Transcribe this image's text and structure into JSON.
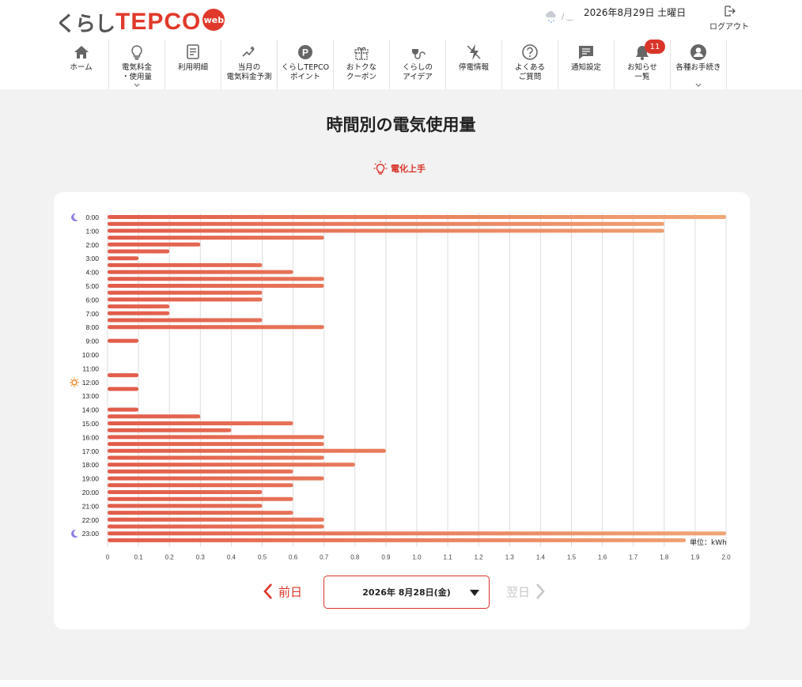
{
  "header": {
    "logo_kurashi": "くらし",
    "logo_tepco": "TEPCO",
    "logo_web": "web",
    "weather_icon": "cloud-rain-icon",
    "weather_text": "/ ‿",
    "date": "2026年8月29日 土曜日",
    "logout_label": "ログアウト"
  },
  "nav": [
    {
      "label": "ホーム",
      "icon": "home-icon"
    },
    {
      "label": "電気料金\n・使用量",
      "icon": "bulb-icon",
      "chevron": true
    },
    {
      "label": "利用明細",
      "icon": "document-icon"
    },
    {
      "label": "当月の\n電気料金予測",
      "icon": "forecast-icon"
    },
    {
      "label": "くらしTEPCO\nポイント",
      "icon": "point-icon"
    },
    {
      "label": "おトクな\nクーポン",
      "icon": "gift-icon"
    },
    {
      "label": "くらしの\nアイデア",
      "icon": "plug-icon"
    },
    {
      "label": "停電情報",
      "icon": "outage-icon"
    },
    {
      "label": "よくある\nご質問",
      "icon": "question-icon"
    },
    {
      "label": "通知設定",
      "icon": "message-icon"
    },
    {
      "label": "お知らせ\n一覧",
      "icon": "bell-icon",
      "badge": "11"
    },
    {
      "label": "各種お手続き",
      "icon": "user-icon",
      "chevron": true
    }
  ],
  "page": {
    "title": "時間別の電気使用量",
    "denka_label": "電化上手",
    "unit_label": "単位：kWh",
    "prev_label": "前日",
    "next_label": "翌日",
    "selected_date": "2026年 8月28日(金)"
  },
  "colors": {
    "accent": "#d9342a",
    "bar_start": "#e25c4a",
    "bar_end": "#f0a676",
    "moon": "#8c7ee6",
    "sun": "#f08a2c"
  },
  "chart_data": {
    "type": "bar",
    "orientation": "horizontal",
    "categories": [
      "0:00",
      "0:30",
      "1:00",
      "1:30",
      "2:00",
      "2:30",
      "3:00",
      "3:30",
      "4:00",
      "4:30",
      "5:00",
      "5:30",
      "6:00",
      "6:30",
      "7:00",
      "7:30",
      "8:00",
      "8:30",
      "9:00",
      "9:30",
      "10:00",
      "10:30",
      "11:00",
      "11:30",
      "12:00",
      "12:30",
      "13:00",
      "13:30",
      "14:00",
      "14:30",
      "15:00",
      "15:30",
      "16:00",
      "16:30",
      "17:00",
      "17:30",
      "18:00",
      "18:30",
      "19:00",
      "19:30",
      "20:00",
      "20:30",
      "21:00",
      "21:30",
      "22:00",
      "22:30",
      "23:00",
      "23:30"
    ],
    "tick_labels": [
      "0:00",
      "1:00",
      "2:00",
      "3:00",
      "4:00",
      "5:00",
      "6:00",
      "7:00",
      "8:00",
      "9:00",
      "10:00",
      "11:00",
      "12:00",
      "13:00",
      "14:00",
      "15:00",
      "16:00",
      "17:00",
      "18:00",
      "19:00",
      "20:00",
      "21:00",
      "22:00",
      "23:00"
    ],
    "values": [
      2.0,
      1.8,
      1.8,
      0.7,
      0.3,
      0.2,
      0.1,
      0.5,
      0.6,
      0.7,
      0.7,
      0.5,
      0.5,
      0.2,
      0.2,
      0.5,
      0.7,
      0.0,
      0.1,
      0.0,
      0.0,
      0.0,
      0.0,
      0.1,
      0.0,
      0.1,
      0.0,
      0.0,
      0.1,
      0.3,
      0.6,
      0.4,
      0.7,
      0.7,
      0.9,
      0.7,
      0.8,
      0.6,
      0.7,
      0.6,
      0.5,
      0.6,
      0.5,
      0.6,
      0.7,
      0.7,
      2.0,
      1.87
    ],
    "xlim": [
      0,
      2.0
    ],
    "xticks": [
      "0",
      "0.1",
      "0.2",
      "0.3",
      "0.4",
      "0.5",
      "0.6",
      "0.7",
      "0.8",
      "0.9",
      "1.0",
      "1.1",
      "1.2",
      "1.3",
      "1.4",
      "1.5",
      "1.6",
      "1.7",
      "1.8",
      "1.9",
      "2.0"
    ],
    "grid": true,
    "markers": [
      {
        "label": "0:00",
        "icon": "moon-icon"
      },
      {
        "label": "12:00",
        "icon": "sun-icon"
      },
      {
        "label": "23:00",
        "icon": "moon-icon"
      }
    ]
  }
}
